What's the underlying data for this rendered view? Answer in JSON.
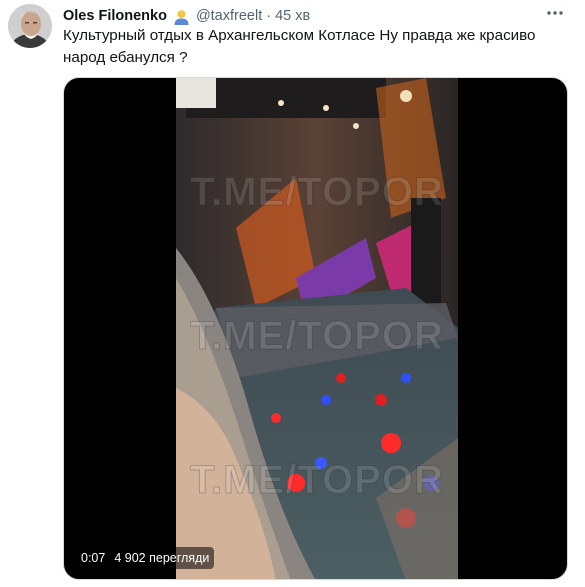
{
  "tweet": {
    "author": {
      "display_name": "Oles Filonenko",
      "emoji_icon": "person-emoji-icon",
      "handle": "@taxfreelt",
      "separator": "·",
      "time": "45 хв"
    },
    "text": "Культурный отдых в Архангельском Котласе Ну правда же красиво народ ебанулся ?",
    "more_icon": "more-horizontal-icon",
    "media": {
      "watermark": "T.ME/TOPOR",
      "duration": "0:07",
      "views": "4 902 перегляди"
    }
  },
  "colors": {
    "text_primary": "#0f1419",
    "text_secondary": "#536471",
    "media_background": "#000000"
  }
}
